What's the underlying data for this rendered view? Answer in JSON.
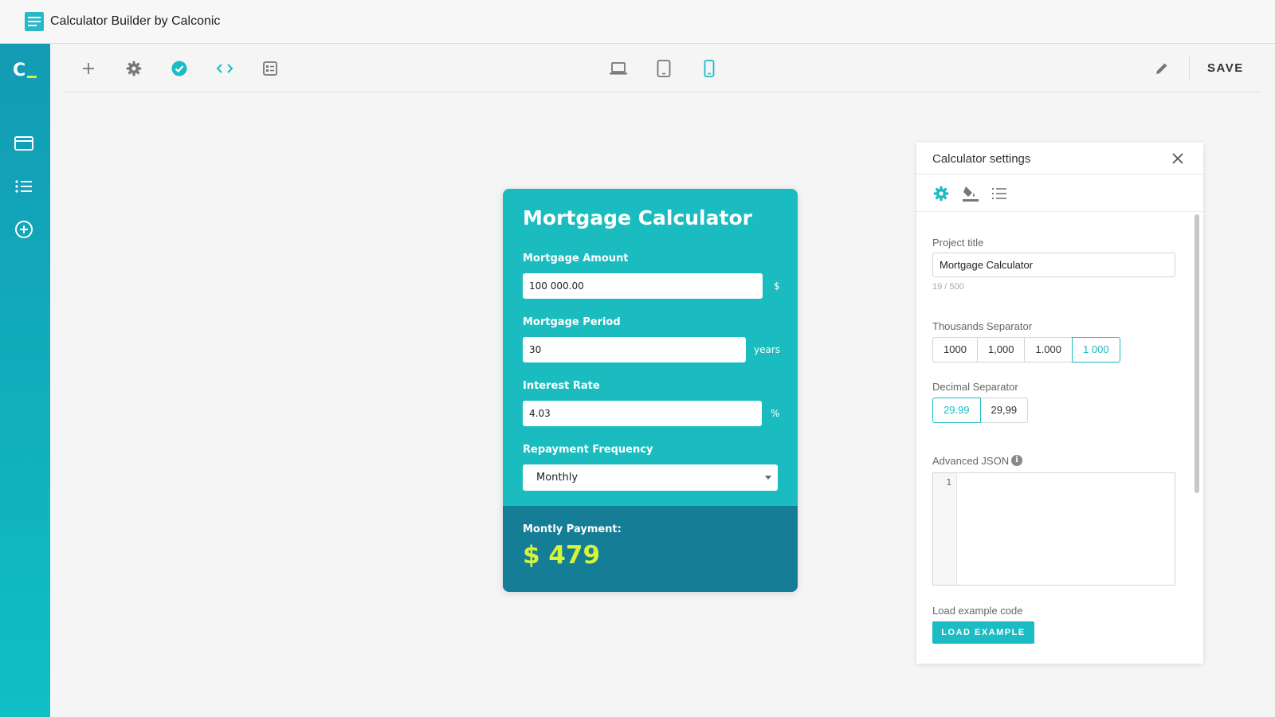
{
  "app": {
    "title": "Calculator Builder by Calconic"
  },
  "sidebar": {
    "brand": "C",
    "items": [
      {
        "icon": "card-icon"
      },
      {
        "icon": "list-icon"
      },
      {
        "icon": "add-circle-icon"
      }
    ]
  },
  "toolbar": {
    "left_icons": [
      "plus-icon",
      "gear-icon",
      "check-circle-icon",
      "code-icon",
      "form-icon"
    ],
    "devices": [
      "laptop-icon",
      "tablet-icon",
      "phone-icon"
    ],
    "active_device": "phone-icon",
    "save_label": "SAVE"
  },
  "calculator": {
    "title": "Mortgage Calculator",
    "fields": [
      {
        "label": "Mortgage Amount",
        "value": "100 000.00",
        "unit": "$"
      },
      {
        "label": "Mortgage Period",
        "value": "30",
        "unit": "years"
      },
      {
        "label": "Interest Rate",
        "value": "4.03",
        "unit": "%"
      }
    ],
    "frequency": {
      "label": "Repayment Frequency",
      "value": "Monthly"
    },
    "result": {
      "label": "Montly Payment:",
      "value": "$ 479"
    }
  },
  "settings": {
    "title": "Calculator settings",
    "tabs": [
      "gear-icon",
      "paint-bucket-icon",
      "numbered-list-icon"
    ],
    "project_title": {
      "label": "Project title",
      "value": "Mortgage Calculator",
      "counter": "19 / 500"
    },
    "thousands": {
      "label": "Thousands Separator",
      "options": [
        "1000",
        "1,000",
        "1.000",
        "1 000"
      ],
      "selected": "1 000"
    },
    "decimal": {
      "label": "Decimal Separator",
      "options": [
        "29.99",
        "29,99"
      ],
      "selected": "29.99"
    },
    "advanced_json": {
      "label": "Advanced JSON",
      "line_number": "1"
    },
    "load_example": {
      "label": "Load example code",
      "button": "LOAD EXAMPLE"
    }
  },
  "colors": {
    "accent": "#1bbcc4",
    "sidebar_top": "#139bb4",
    "result_bg": "#157d96",
    "result_value": "#d4f53c"
  }
}
